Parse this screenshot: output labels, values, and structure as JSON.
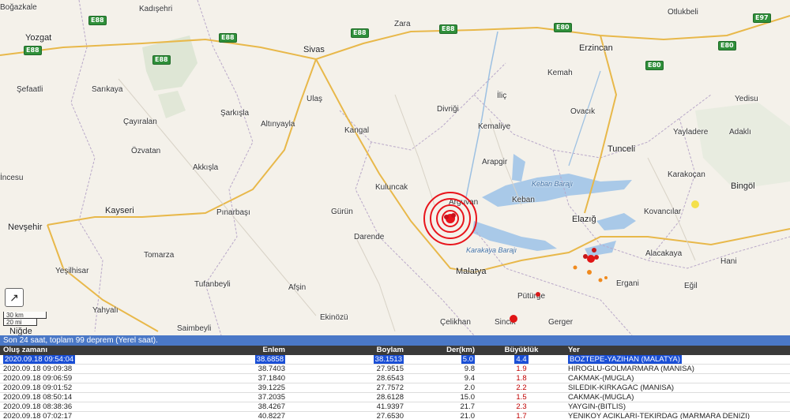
{
  "map": {
    "places": [
      {
        "name": "Boğazkale",
        "kind": "town"
      },
      {
        "name": "Kadışehri",
        "kind": "town"
      },
      {
        "name": "Zara",
        "kind": "town"
      },
      {
        "name": "Otlukbeli",
        "kind": "town"
      },
      {
        "name": "Yozgat",
        "kind": "city"
      },
      {
        "name": "Sivas",
        "kind": "city"
      },
      {
        "name": "Erzincan",
        "kind": "city"
      },
      {
        "name": "Kemah",
        "kind": "town"
      },
      {
        "name": "Şefaatli",
        "kind": "town"
      },
      {
        "name": "Sarıkaya",
        "kind": "town"
      },
      {
        "name": "Ulaş",
        "kind": "town"
      },
      {
        "name": "İliç",
        "kind": "town"
      },
      {
        "name": "Yedisu",
        "kind": "town"
      },
      {
        "name": "Şarkışla",
        "kind": "town"
      },
      {
        "name": "Divriği",
        "kind": "town"
      },
      {
        "name": "Ovacık",
        "kind": "town"
      },
      {
        "name": "Çayıralan",
        "kind": "town"
      },
      {
        "name": "Altınyayla",
        "kind": "town"
      },
      {
        "name": "Kangal",
        "kind": "town"
      },
      {
        "name": "Kemaliye",
        "kind": "town"
      },
      {
        "name": "Yayladere",
        "kind": "town"
      },
      {
        "name": "Adaklı",
        "kind": "town"
      },
      {
        "name": "Özvatan",
        "kind": "town"
      },
      {
        "name": "Tunceli",
        "kind": "city"
      },
      {
        "name": "Akkışla",
        "kind": "town"
      },
      {
        "name": "Arapgir",
        "kind": "town"
      },
      {
        "name": "Karakoçan",
        "kind": "town"
      },
      {
        "name": "İncesu",
        "kind": "town"
      },
      {
        "name": "Kuluncak",
        "kind": "town"
      },
      {
        "name": "Bingöl",
        "kind": "city"
      },
      {
        "name": "Keban Barajı",
        "kind": "water"
      },
      {
        "name": "Arguvan",
        "kind": "town"
      },
      {
        "name": "Keban",
        "kind": "town"
      },
      {
        "name": "Kayseri",
        "kind": "city"
      },
      {
        "name": "Pınarbaşı",
        "kind": "town"
      },
      {
        "name": "Gürün",
        "kind": "town"
      },
      {
        "name": "Elazığ",
        "kind": "city"
      },
      {
        "name": "Kovancılar",
        "kind": "town"
      },
      {
        "name": "Nevşehir",
        "kind": "city"
      },
      {
        "name": "Darende",
        "kind": "town"
      },
      {
        "name": "Karakaya Barajı",
        "kind": "water"
      },
      {
        "name": "Alacakaya",
        "kind": "town"
      },
      {
        "name": "Tomarza",
        "kind": "town"
      },
      {
        "name": "Hani",
        "kind": "town"
      },
      {
        "name": "Yeşilhisar",
        "kind": "town"
      },
      {
        "name": "Malatya",
        "kind": "city"
      },
      {
        "name": "Tufanbeyli",
        "kind": "town"
      },
      {
        "name": "Ergani",
        "kind": "town"
      },
      {
        "name": "Eğil",
        "kind": "town"
      },
      {
        "name": "Afşin",
        "kind": "town"
      },
      {
        "name": "Pütürge",
        "kind": "town"
      },
      {
        "name": "Yahyalı",
        "kind": "town"
      },
      {
        "name": "Ekinözü",
        "kind": "town"
      },
      {
        "name": "Çelikhan",
        "kind": "town"
      },
      {
        "name": "Sincik",
        "kind": "town"
      },
      {
        "name": "Gerger",
        "kind": "town"
      },
      {
        "name": "Saimbeyli",
        "kind": "town"
      },
      {
        "name": "Niğde",
        "kind": "city"
      }
    ],
    "roads": [
      "E88",
      "E88",
      "E88",
      "E88",
      "E88",
      "E88",
      "E80",
      "E80",
      "E80",
      "E97"
    ],
    "scale": {
      "km": "30 km",
      "mi": "20 mi"
    },
    "fullscreen_icon": "expand-arrow-icon",
    "colors": {
      "quake_major": "#e8141b",
      "quake_minor": "#d81a1a",
      "quake_orange": "#f08a1e",
      "quake_yellow": "#f4e04a"
    }
  },
  "panel": {
    "title": "Son 24 saat, toplam 99 deprem (Yerel saat).",
    "columns": [
      "Oluş zamanı",
      "Enlem",
      "Boylam",
      "Der(km)",
      "Büyüklük",
      "Yer"
    ],
    "rows": [
      {
        "time": "2020.09.18 09:54:04",
        "lat": "38.6858",
        "lon": "38.1513",
        "depth": "5.0",
        "mag": "4.4",
        "place": "BOZTEPE-YAZIHAN (MALATYA)",
        "selected": true
      },
      {
        "time": "2020.09.18 09:09:38",
        "lat": "38.7403",
        "lon": "27.9515",
        "depth": "9.8",
        "mag": "1.9",
        "place": "HIROGLU-GOLMARMARA (MANISA)"
      },
      {
        "time": "2020.09.18 09:06:59",
        "lat": "37.1840",
        "lon": "28.6543",
        "depth": "9.4",
        "mag": "1.8",
        "place": "CAKMAK-(MUGLA)"
      },
      {
        "time": "2020.09.18 09:01:52",
        "lat": "39.1225",
        "lon": "27.7572",
        "depth": "2.0",
        "mag": "2.2",
        "place": "SILEDIK-KIRKAGAC (MANISA)"
      },
      {
        "time": "2020.09.18 08:50:14",
        "lat": "37.2035",
        "lon": "28.6128",
        "depth": "15.0",
        "mag": "1.5",
        "place": "CAKMAK-(MUGLA)"
      },
      {
        "time": "2020.09.18 08:38:36",
        "lat": "38.4267",
        "lon": "41.9397",
        "depth": "21.7",
        "mag": "2.3",
        "place": "YAYGIN-(BITLIS)"
      },
      {
        "time": "2020.09.18 07:02:17",
        "lat": "40.8227",
        "lon": "27.6530",
        "depth": "21.0",
        "mag": "1.7",
        "place": "YENIKOY ACIKLARI-TEKIRDAG (MARMARA DENIZI)"
      }
    ]
  }
}
